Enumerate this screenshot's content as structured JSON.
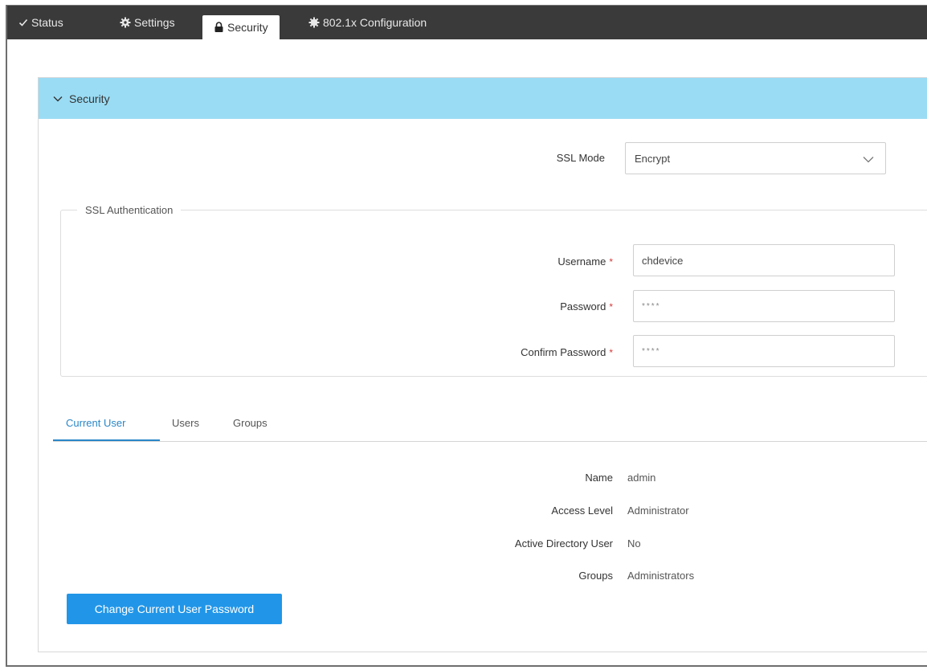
{
  "top_tabs": [
    {
      "label": "Status",
      "icon": "check-icon"
    },
    {
      "label": "Settings",
      "icon": "gear-icon"
    },
    {
      "label": "Security",
      "icon": "lock-icon"
    },
    {
      "label": "802.1x Configuration",
      "icon": "gear-icon"
    }
  ],
  "active_top_tab": "Security",
  "section": {
    "title": "Security"
  },
  "ssl_mode": {
    "label": "SSL Mode",
    "value": "Encrypt"
  },
  "ssl_auth": {
    "legend": "SSL Authentication",
    "username": {
      "label": "Username",
      "value": "chdevice"
    },
    "password": {
      "label": "Password",
      "value": "****"
    },
    "confirm_password": {
      "label": "Confirm Password",
      "value": "****"
    },
    "required_mark": "*"
  },
  "user_tabs": [
    {
      "label": "Current User"
    },
    {
      "label": "Users"
    },
    {
      "label": "Groups"
    }
  ],
  "current_user": {
    "name": {
      "label": "Name",
      "value": "admin"
    },
    "access_level": {
      "label": "Access Level",
      "value": "Administrator"
    },
    "ad_user": {
      "label": "Active Directory User",
      "value": "No"
    },
    "groups": {
      "label": "Groups",
      "value": "Administrators"
    }
  },
  "change_password_button": "Change Current User Password",
  "colors": {
    "topbar": "#3a3a3a",
    "section_header": "#9adcf4",
    "accent": "#2a87c8",
    "button": "#2196e8",
    "required": "#d43b3b"
  }
}
